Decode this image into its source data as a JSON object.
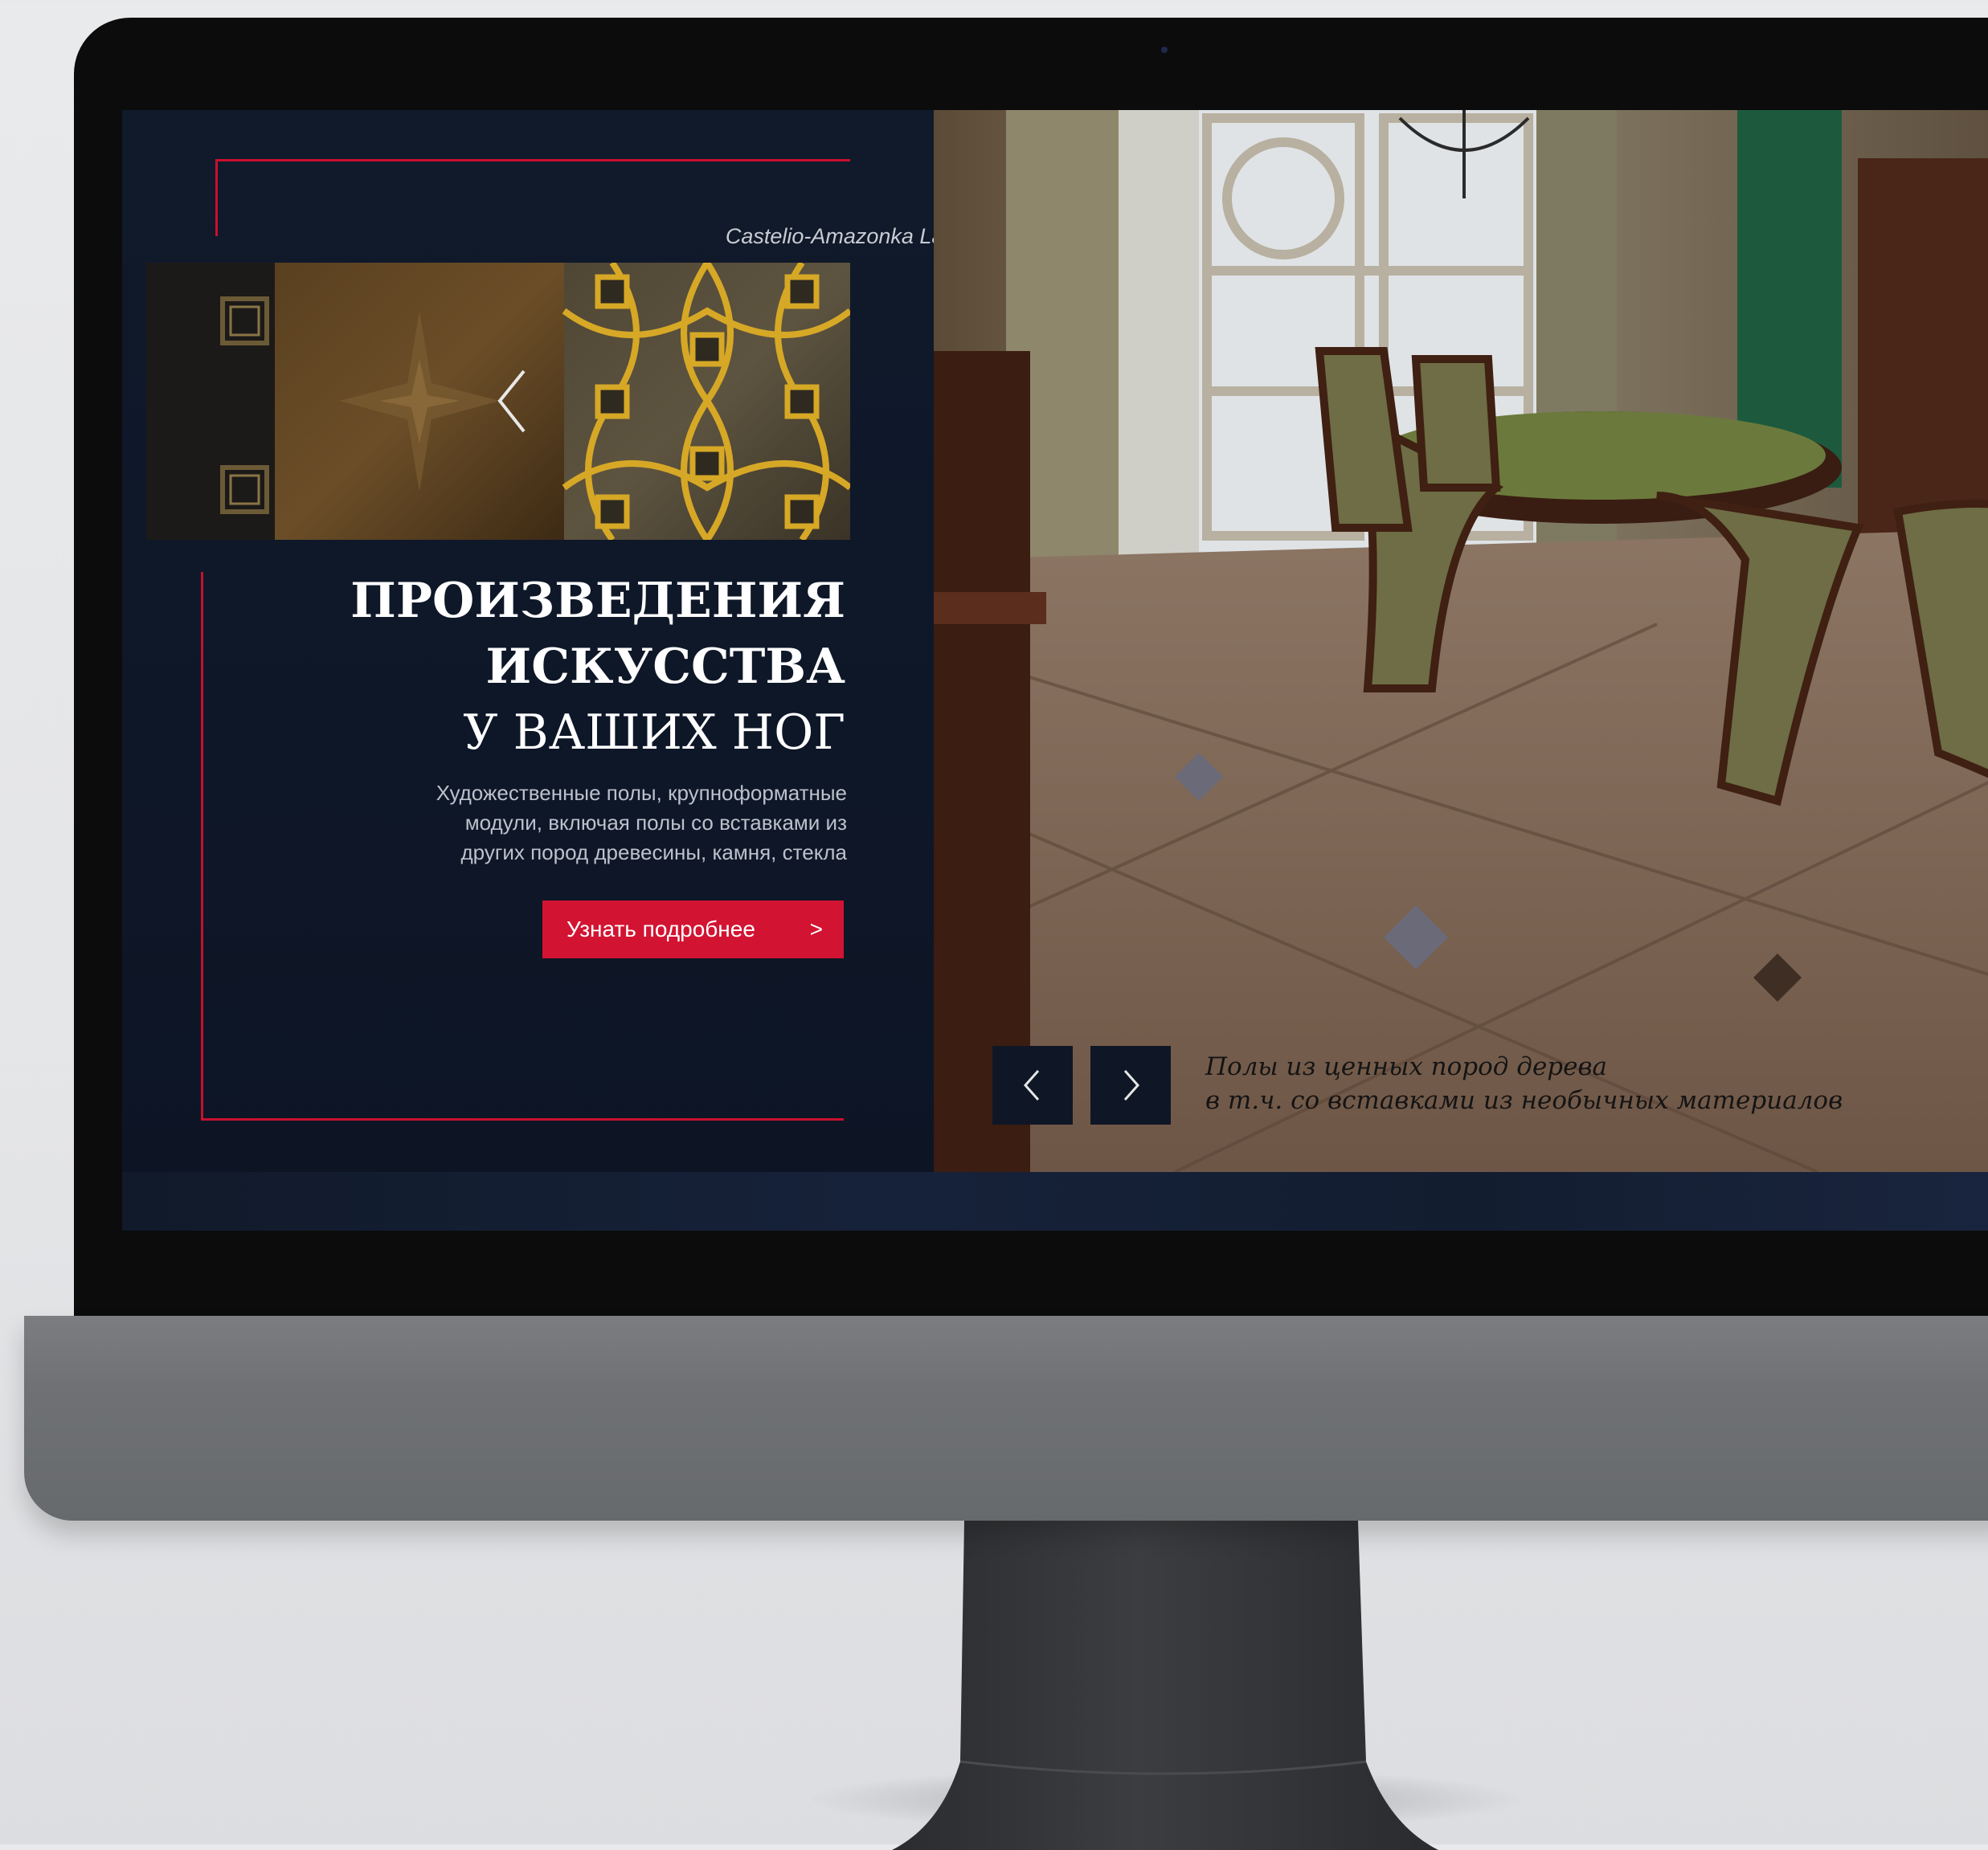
{
  "hero": {
    "product_caption": "Castelio-Amazonka Latun",
    "headline_line1": "ПРОИЗВЕДЕНИЯ",
    "headline_line2": "ИСКУССТВА",
    "headline_line3": "У ВАШИХ НОГ",
    "description_line1": "Художественные полы, крупноформатные",
    "description_line2": "модули, включая полы со вставками из",
    "description_line3": "других пород древесины, камня, стекла",
    "cta_label": "Узнать подробнее",
    "cta_arrow": ">"
  },
  "slider": {
    "caption_line1": "Полы из ценных пород дерева",
    "caption_line2": "в т.ч. со вставками из необычных материалов",
    "prev_icon": "chevron-left-icon",
    "next_icon": "chevron-right-icon"
  },
  "device": {
    "logo": "apple-logo-icon"
  },
  "colors": {
    "accent_red": "#d31332",
    "panel_navy": "#101a2b",
    "gold": "#c9a23a"
  }
}
